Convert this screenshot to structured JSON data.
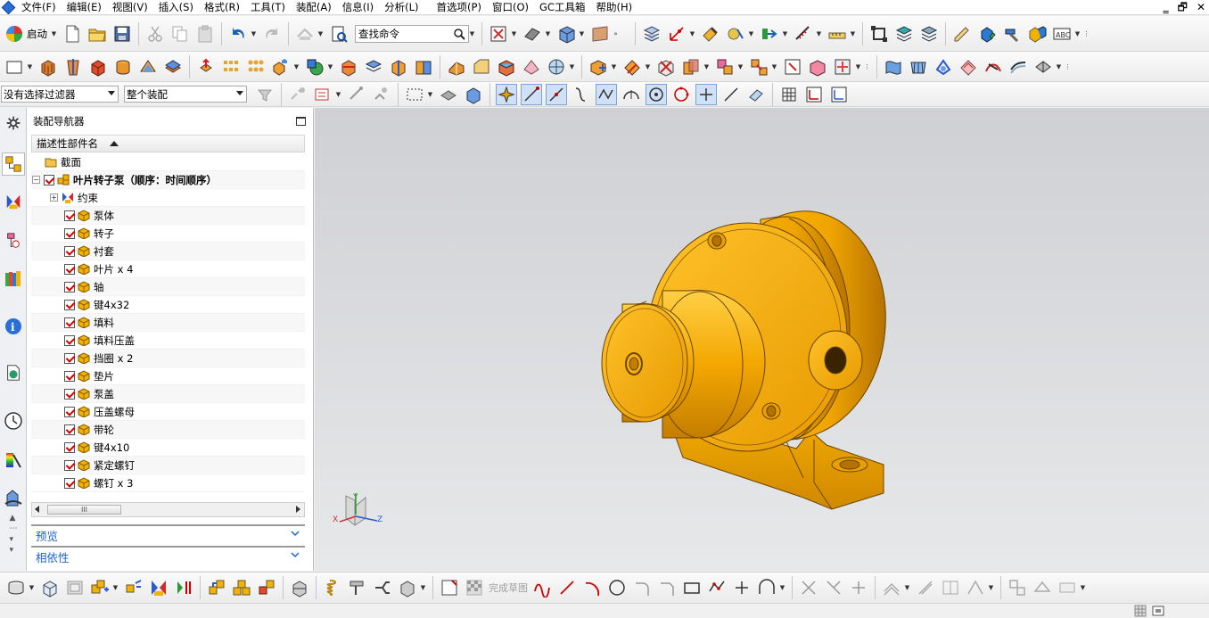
{
  "menubar": {
    "items": [
      "文件(F)",
      "编辑(E)",
      "视图(V)",
      "插入(S)",
      "格式(R)",
      "工具(T)",
      "装配(A)",
      "信息(I)",
      "分析(L)",
      "首选项(P)",
      "窗口(O)",
      "GC工具箱",
      "帮助(H)"
    ],
    "window_controls": [
      "‗",
      "🗗",
      "✕"
    ]
  },
  "toolbar_top": {
    "start_label": "启动",
    "search_placeholder": "查找命令"
  },
  "selection_bar": {
    "filter_value": "没有选择过滤器",
    "scope_value": "整个装配"
  },
  "navigator": {
    "title": "装配导航器",
    "column_header": "描述性部件名",
    "rows": [
      {
        "label": "截面",
        "kind": "folder"
      },
      {
        "label": "叶片转子泵（顺序：时间顺序）",
        "kind": "assembly"
      },
      {
        "label": "约束",
        "kind": "constraints"
      },
      {
        "label": "泵体",
        "kind": "part"
      },
      {
        "label": "转子",
        "kind": "part"
      },
      {
        "label": "衬套",
        "kind": "part"
      },
      {
        "label": "叶片 x 4",
        "kind": "part"
      },
      {
        "label": "轴",
        "kind": "part"
      },
      {
        "label": "键4x32",
        "kind": "part"
      },
      {
        "label": "填料",
        "kind": "part"
      },
      {
        "label": "填料压盖",
        "kind": "part"
      },
      {
        "label": "挡圈 x 2",
        "kind": "part"
      },
      {
        "label": "垫片",
        "kind": "part"
      },
      {
        "label": "泵盖",
        "kind": "part"
      },
      {
        "label": "压盖螺母",
        "kind": "part"
      },
      {
        "label": "带轮",
        "kind": "part"
      },
      {
        "label": "键4x10",
        "kind": "part"
      },
      {
        "label": "紧定螺钉",
        "kind": "part"
      },
      {
        "label": "螺钉 x 3",
        "kind": "part"
      }
    ],
    "scroll_thumb_text": "III",
    "panels": [
      "预览",
      "相依性"
    ]
  },
  "bottom_toolbar": {
    "finish_sketch_label": "完成草图"
  },
  "viewport": {
    "triad_labels": {
      "x": "X",
      "y": "Y",
      "z": "Z"
    }
  },
  "colors": {
    "part_color": "#f4a800",
    "checkbox_check": "#d10000",
    "panel_text": "#1c64c8",
    "viewport_top": "#cfd0d3",
    "viewport_bottom": "#e7e8ea"
  }
}
